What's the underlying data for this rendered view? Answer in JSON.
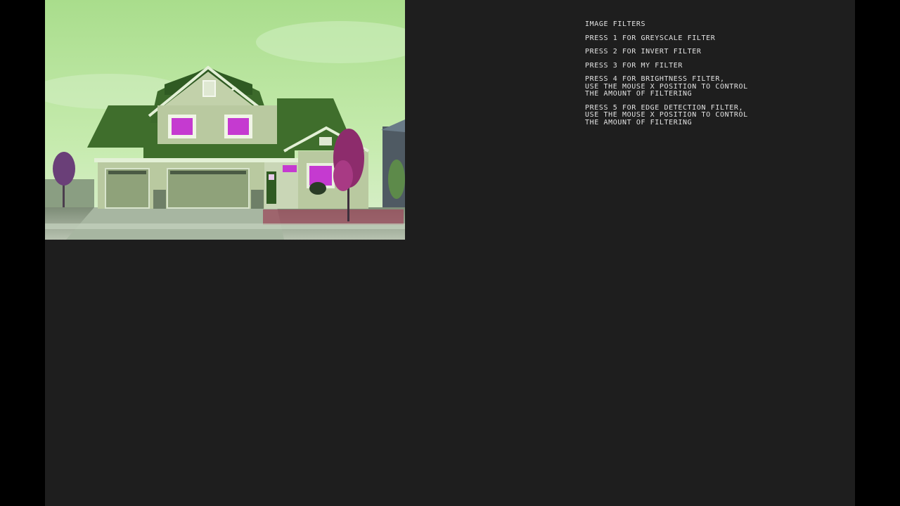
{
  "instructions": {
    "title": "IMAGE FILTERS",
    "items": [
      {
        "lines": [
          "PRESS 1 FOR GREYSCALE FILTER"
        ]
      },
      {
        "lines": [
          "PRESS 2 FOR INVERT FILTER"
        ]
      },
      {
        "lines": [
          "PRESS 3 FOR MY FILTER"
        ]
      },
      {
        "lines": [
          "PRESS 4 FOR BRIGHTNESS FILTER,",
          "USE THE MOUSE X POSITION TO CONTROL",
          "THE AMOUNT OF FILTERING"
        ]
      },
      {
        "lines": [
          "PRESS 5 FOR EDGE DETECTION FILTER,",
          "USE THE MOUSE X POSITION TO CONTROL",
          "THE AMOUNT OF FILTERING"
        ]
      }
    ]
  },
  "image": {
    "subject": "house-photo-filtered"
  },
  "colors": {
    "page_background": "#000000",
    "canvas_background": "#1e1e1e",
    "text": "#e2e2e2",
    "sky": "#b6e39a",
    "roof": "#3f6e2c",
    "siding": "#b9c9a0",
    "accent_magenta": "#c53ad0"
  }
}
